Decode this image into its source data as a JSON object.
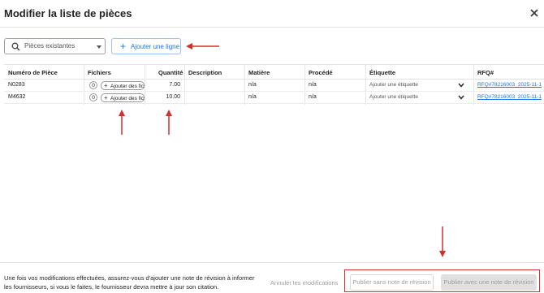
{
  "header": {
    "title": "Modifier la liste de pièces",
    "close_icon": "close-icon"
  },
  "toolbar": {
    "search_placeholder": "Pièces existantes",
    "add_line_label": "Ajouter une ligne"
  },
  "table": {
    "columns": [
      "Numéro de Pièce",
      "Fichiers",
      "Quantité",
      "Description",
      "Matière",
      "Procédé",
      "Étiquette",
      "RFQ#"
    ],
    "rows": [
      {
        "part_number": "N0283",
        "file_count": "0",
        "attach_label": "Ajouter des fic",
        "quantity": "7.00",
        "description": "",
        "material": "n/a",
        "process": "n/a",
        "tag_placeholder": "Ajouter une étiquette",
        "rfq": "RFQ#78216003_2025-11-1"
      },
      {
        "part_number": "M4632",
        "file_count": "0",
        "attach_label": "Ajouter des fic",
        "quantity": "10.00",
        "description": "",
        "material": "n/a",
        "process": "n/a",
        "tag_placeholder": "Ajouter une étiquette",
        "rfq": "RFQ#78216003_2025-11-1"
      }
    ]
  },
  "footer": {
    "note": "Une fois vos modifications effectuées, assurez-vous d'ajouter une note de révision à informer les fournisseurs, si vous le faites, le fournisseur devra mettre à jour son citation.",
    "cancel_label": "Annuler les modifications",
    "publish_without_note_label": "Publier sans note de révision",
    "publish_with_note_label": "Publier avec une note de révision"
  },
  "colors": {
    "accent": "#1a73e8",
    "annotation": "#d32f2f",
    "disabled_text": "#9e9e9e"
  }
}
